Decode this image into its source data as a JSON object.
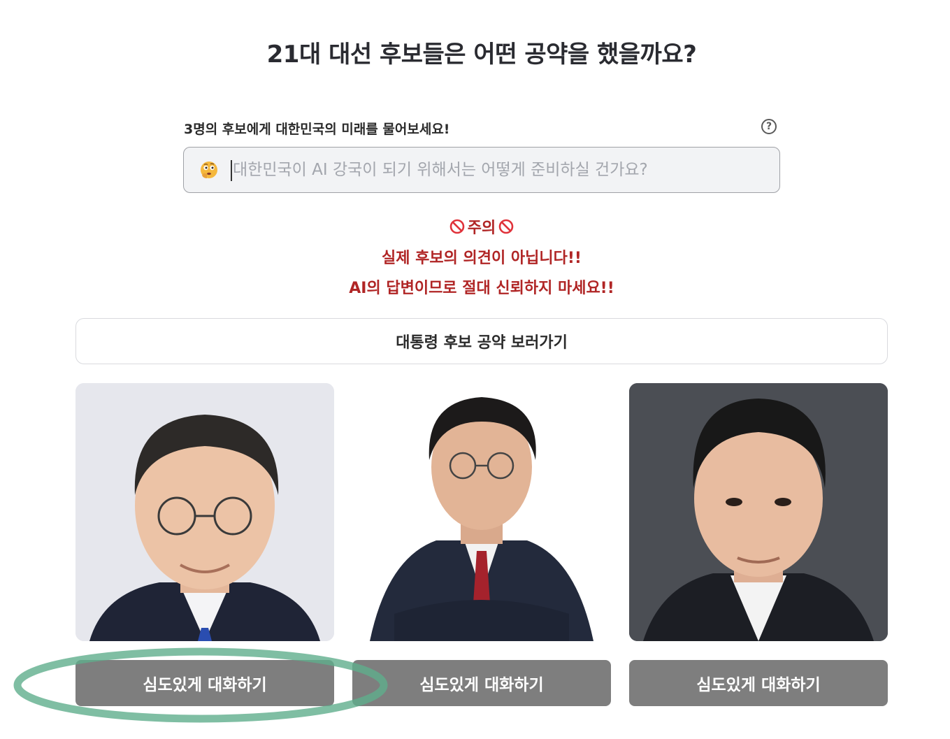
{
  "page": {
    "title": "21대 대선 후보들은 어떤 공약을 했을까요?"
  },
  "prompt": {
    "label": "3명의 후보에게 대한민국의 미래를 물어보세요!",
    "help_icon": "question-circle-icon",
    "input_value": "",
    "input_placeholder": "대한민국이 AI 강국이 되기 위해서는 어떻게 준비하실 건가요?",
    "emoji_icon": "thinking-face-emoji-icon"
  },
  "warning": {
    "heading": "주의",
    "heading_icon": "no-entry-icon",
    "line1": "실제 후보의 의견이 아닙니다!!",
    "line2": "AI의 답변이므로 절대 신뢰하지 마세요!!",
    "color": "#b02525"
  },
  "pledge_button": {
    "label": "대통령 후보 공약 보러가기"
  },
  "candidates": [
    {
      "photo": "candidate-photo-1",
      "button_label": "심도있게 대화하기"
    },
    {
      "photo": "candidate-photo-2",
      "button_label": "심도있게 대화하기"
    },
    {
      "photo": "candidate-photo-3",
      "button_label": "심도있게 대화하기"
    }
  ],
  "colors": {
    "talk_button_bg": "#7e7e7e",
    "highlight_ring": "#5fae8c"
  }
}
